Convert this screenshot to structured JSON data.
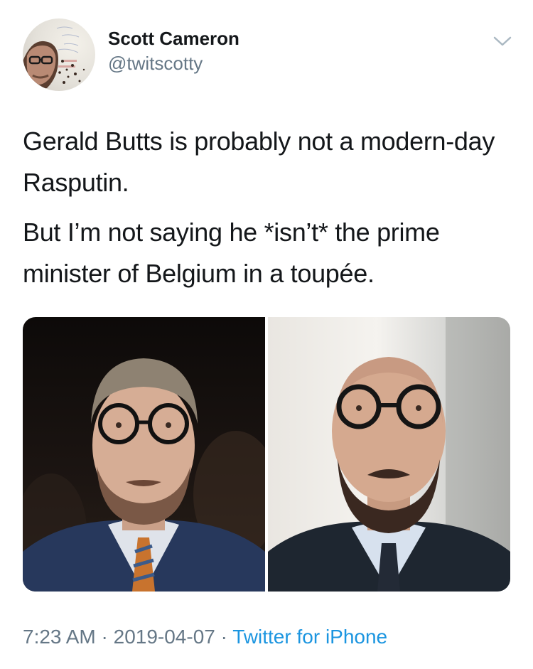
{
  "tweet": {
    "author": {
      "display_name": "Scott Cameron",
      "handle": "@twitscotty",
      "avatar_icon": "avatar-photo"
    },
    "menu_icon": "chevron-down-icon",
    "text_paragraphs": [
      "Gerald Butts is probably not a modern-day Rasputin.",
      "But I’m not saying he *isn’t* the prime minister of Belgium in a toupée."
    ],
    "media": [
      {
        "name": "photo-left",
        "icon": "portrait-photo"
      },
      {
        "name": "photo-right",
        "icon": "portrait-photo"
      }
    ],
    "meta": {
      "time": "7:23 AM",
      "separator": " · ",
      "date": "2019-04-07",
      "source": "Twitter for iPhone"
    }
  },
  "colors": {
    "text": "#14171a",
    "secondary": "#657786",
    "link": "#1b95e0"
  }
}
